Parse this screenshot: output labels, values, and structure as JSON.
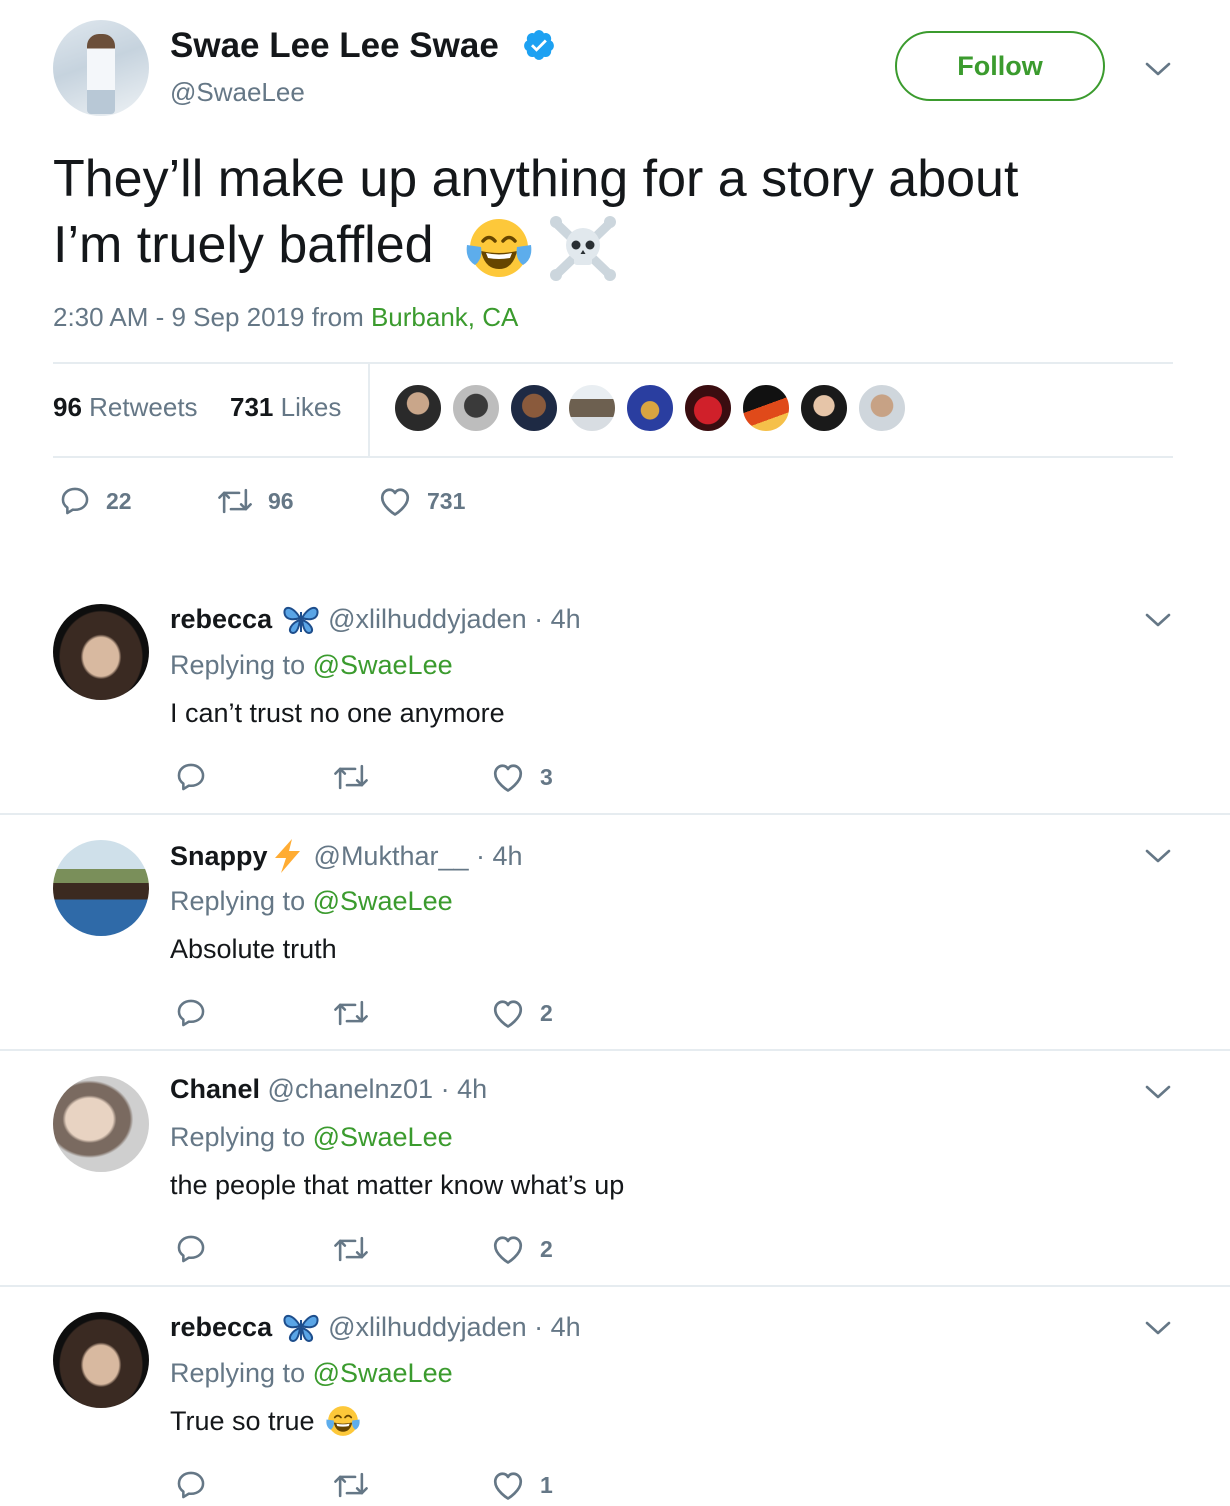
{
  "tweet": {
    "author_name": "Swae Lee Lee Swae",
    "author_handle": "@SwaeLee",
    "follow_label": "Follow",
    "text_line1": "They’ll make up anything for a story about",
    "text_line2": "I’m truely baffled",
    "emojis": [
      "face-with-tears-of-joy",
      "skull-and-crossbones"
    ],
    "timestamp": "2:30 AM - 9 Sep 2019 from",
    "location": "Burbank, CA",
    "retweets_count": "96",
    "retweets_label": "Retweets",
    "likes_count": "731",
    "likes_label": "Likes",
    "liker_avatar_count": 9,
    "actions": {
      "replies": "22",
      "retweets": "96",
      "likes": "731"
    }
  },
  "replies": [
    {
      "name": "rebecca",
      "badge": "butterfly",
      "handle": "@xlilhuddyjaden",
      "time": "· 4h",
      "replying_prefix": "Replying to",
      "replying_to": "@SwaeLee",
      "text": "I can’t trust no one anymore",
      "likes": "3"
    },
    {
      "name": "Snappy",
      "badge": "lightning",
      "handle": "@Mukthar__",
      "time": "· 4h",
      "replying_prefix": "Replying to",
      "replying_to": "@SwaeLee",
      "text": "Absolute truth",
      "likes": "2"
    },
    {
      "name": "Chanel",
      "badge": "",
      "handle": "@chanelnz01",
      "time": "· 4h",
      "replying_prefix": "Replying to",
      "replying_to": "@SwaeLee",
      "text": "the people that matter know what’s up",
      "likes": "2"
    },
    {
      "name": "rebecca",
      "badge": "butterfly",
      "handle": "@xlilhuddyjaden",
      "time": "· 4h",
      "replying_prefix": "Replying to",
      "replying_to": "@SwaeLee",
      "text": "True so true",
      "likes": "1"
    }
  ],
  "colors": {
    "accent_green": "#3b9b2e",
    "verified_blue": "#1da1f2",
    "muted": "#657786",
    "divider": "#e6ecf0"
  }
}
